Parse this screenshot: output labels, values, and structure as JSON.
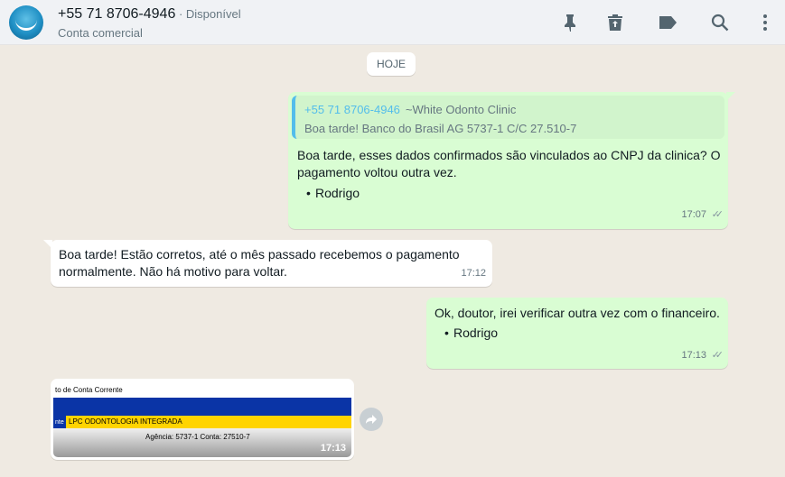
{
  "header": {
    "contact_name": "+55 71 8706-4946",
    "status": " · Disponível",
    "subtitle": "Conta comercial",
    "icons": [
      "pin-icon",
      "delete-icon",
      "label-icon",
      "search-icon",
      "menu-icon"
    ]
  },
  "date_label": "HOJE",
  "messages": [
    {
      "direction": "out",
      "quote_sender": "+55 71 8706-4946",
      "quote_name": "~White Odonto Clinic",
      "quote_text": "Boa tarde! Banco do Brasil  AG 5737-1  C/C 27.510-7",
      "text_line1": "Boa tarde, esses dados confirmados são vinculados ao CNPJ da clinica? O",
      "text_line2": "pagamento voltou outra vez.",
      "signature": "Rodrigo",
      "time": "17:07"
    },
    {
      "direction": "in",
      "text_line1": "Boa tarde! Estão corretos, até o mês passado recebemos o pagamento",
      "text_line2": "normalmente. Não há motivo para voltar.",
      "time": "17:12"
    },
    {
      "direction": "out",
      "text_line1": "Ok, doutor, irei verificar outra vez com o financeiro.",
      "signature": "Rodrigo",
      "time": "17:13"
    },
    {
      "direction": "in",
      "type": "image",
      "image_header": "to de Conta Corrente",
      "image_short": "nte",
      "image_company": "LPC ODONTOLOGIA INTEGRADA",
      "image_account": "Agência: 5737-1    Conta: 27510-7",
      "time": "17:13"
    }
  ],
  "colors": {
    "background": "#efeae2",
    "outgoing": "#d9fdd3",
    "incoming": "#ffffff",
    "quote_accent": "#53bdeb"
  }
}
